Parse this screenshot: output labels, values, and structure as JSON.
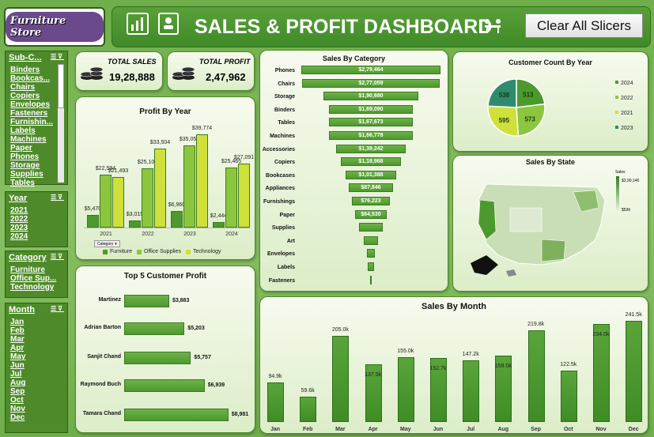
{
  "header": {
    "logo_text": "Furniture Store",
    "title": "SALES & PROFIT DASHBOARD",
    "clear_button": "Clear All Slicers"
  },
  "kpis": {
    "total_sales_label": "TOTAL SALES",
    "total_sales_value": "19,28,888",
    "total_profit_label": "TOTAL PROFIT",
    "total_profit_value": "2,47,962"
  },
  "slicers": {
    "subcategory": {
      "title": "Sub-C...",
      "items": [
        "Binders",
        "Bookcas...",
        "Chairs",
        "Copiers",
        "Envelopes",
        "Fasteners",
        "Furnishin...",
        "Labels",
        "Machines",
        "Paper",
        "Phones",
        "Storage",
        "Supplies",
        "Tables"
      ]
    },
    "year": {
      "title": "Year",
      "items": [
        "2021",
        "2022",
        "2023",
        "2024"
      ]
    },
    "category": {
      "title": "Category",
      "items": [
        "Furniture",
        "Office Sup...",
        "Technology"
      ]
    },
    "month": {
      "title": "Month",
      "items": [
        "Jan",
        "Feb",
        "Mar",
        "Apr",
        "May",
        "Jun",
        "Jul",
        "Aug",
        "Sep",
        "Oct",
        "Nov",
        "Dec"
      ]
    }
  },
  "colors": {
    "furniture": "#4c9a2e",
    "office": "#8cc63f",
    "technology": "#cfe03a",
    "dark": "#3c7a22"
  },
  "profit_by_year": {
    "title": "Profit By Year",
    "filter_label": "Category",
    "legend": [
      "Furniture",
      "Office Supplies",
      "Technology"
    ],
    "chart_data": {
      "type": "bar",
      "categories": [
        "2021",
        "2022",
        "2023",
        "2024"
      ],
      "series": [
        {
          "name": "Furniture",
          "values": [
            5470,
            3015,
            6960,
            2444
          ],
          "labels": [
            "$5,470",
            "$3,015",
            "$6,960",
            "$2,444"
          ]
        },
        {
          "name": "Office Supplies",
          "values": [
            22594,
            25100,
            35053,
            25465
          ],
          "labels": [
            "$22,594",
            "$25,100",
            "$35,053",
            "$25,465"
          ]
        },
        {
          "name": "Technology",
          "values": [
            21493,
            33504,
            39774,
            27091
          ],
          "labels": [
            "$21,493",
            "$33,504",
            "$39,774",
            "$27,091"
          ]
        }
      ]
    }
  },
  "sales_by_category": {
    "title": "Sales By Category",
    "chart_data": {
      "type": "bar",
      "categories": [
        "Phones",
        "Chairs",
        "Storage",
        "Binders",
        "Tables",
        "Machines",
        "Accessories",
        "Copiers",
        "Bookcases",
        "Appliances",
        "Furnishings",
        "Paper",
        "Supplies",
        "Art",
        "Envelopes",
        "Labels",
        "Fasteners"
      ],
      "values": [
        279464,
        277059,
        190680,
        169090,
        167673,
        166778,
        139242,
        118968,
        101388,
        87846,
        76223,
        64530,
        46000,
        27000,
        16000,
        12000,
        3000
      ],
      "labels": [
        "$2,79,464",
        "$2,77,059",
        "$1,90,680",
        "$1,69,090",
        "$1,67,673",
        "$1,66,778",
        "$1,39,242",
        "$1,18,968",
        "$1,01,388",
        "$87,846",
        "$76,223",
        "$64,530",
        "",
        "",
        "",
        "",
        ""
      ]
    }
  },
  "customer_count": {
    "title": "Customer Count By Year",
    "chart_data": {
      "type": "pie",
      "categories": [
        "2024",
        "2022",
        "2021",
        "2023"
      ],
      "values": [
        513,
        573,
        595,
        538
      ],
      "colors": [
        "#4c9a2e",
        "#8cc63f",
        "#cfe03a",
        "#2e8b6e"
      ]
    }
  },
  "sales_by_state": {
    "title": "Sales By State",
    "legend_title": "Sales",
    "legend_max": "$3,90,146",
    "legend_min": "$536"
  },
  "top5": {
    "title": "Top 5 Customer Profit",
    "chart_data": {
      "type": "bar",
      "categories": [
        "Martinez",
        "Adrian Barton",
        "Sanjit Chand",
        "Raymond Buch",
        "Tamara Chand"
      ],
      "values": [
        3883,
        5203,
        5757,
        6939,
        8981
      ],
      "labels": [
        "$3,883",
        "$5,203",
        "$5,757",
        "$6,939",
        "$8,981"
      ]
    }
  },
  "sales_by_month": {
    "title": "Sales By Month",
    "chart_data": {
      "type": "bar",
      "categories": [
        "Jan",
        "Feb",
        "Mar",
        "Apr",
        "May",
        "Jun",
        "Jul",
        "Aug",
        "Sep",
        "Oct",
        "Nov",
        "Dec"
      ],
      "values": [
        94.9,
        59.6,
        205.0,
        137.5,
        155.0,
        152.7,
        147.2,
        159.0,
        219.8,
        122.5,
        234.0,
        241.5
      ],
      "labels": [
        "94.9k",
        "59.6k",
        "205.0k",
        "137.5k",
        "155.0k",
        "152.7k",
        "147.2k",
        "159.0k",
        "219.8k",
        "122.5k",
        "234.0k",
        "241.5k"
      ]
    }
  }
}
